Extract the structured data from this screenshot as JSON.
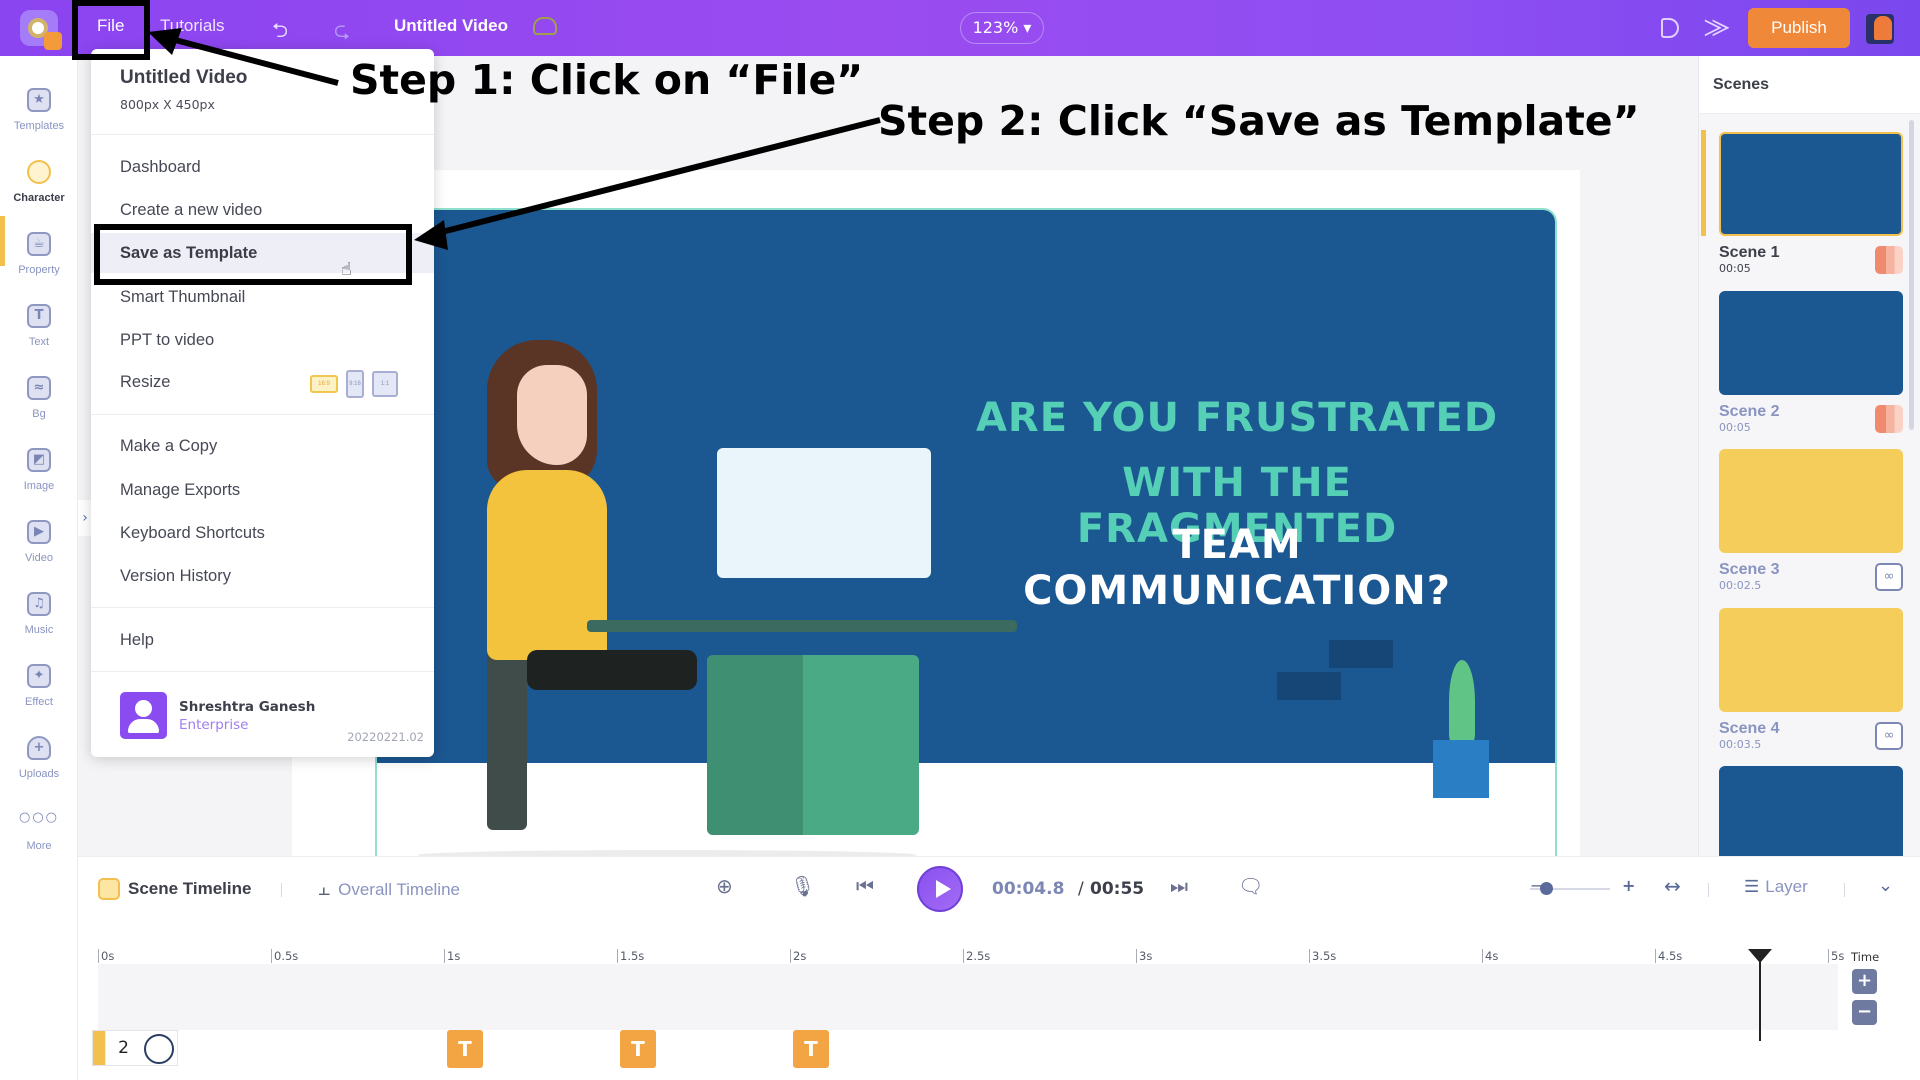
{
  "topbar": {
    "file_label": "File",
    "tutorials_label": "Tutorials",
    "title": "Untitled Video",
    "zoom_level": "123%",
    "publish_label": "Publish",
    "icons": [
      "logo",
      "undo-icon",
      "redo-icon",
      "cloud-saved-icon",
      "preview-icon",
      "share-icon",
      "user-avatar"
    ]
  },
  "sidebar": {
    "items": [
      {
        "label": "Templates",
        "icon": "templates-icon"
      },
      {
        "label": "Character",
        "icon": "character-icon",
        "active": true
      },
      {
        "label": "Property",
        "icon": "property-icon"
      },
      {
        "label": "Text",
        "icon": "text-icon"
      },
      {
        "label": "Bg",
        "icon": "background-icon"
      },
      {
        "label": "Image",
        "icon": "image-icon"
      },
      {
        "label": "Video",
        "icon": "video-icon"
      },
      {
        "label": "Music",
        "icon": "music-icon"
      },
      {
        "label": "Effect",
        "icon": "effect-icon"
      },
      {
        "label": "Uploads",
        "icon": "upload-cloud-icon"
      },
      {
        "label": "More",
        "icon": "more-icon"
      }
    ]
  },
  "file_menu": {
    "title": "Untitled Video",
    "dimensions": "800px X 450px",
    "items": [
      {
        "label": "Dashboard"
      },
      {
        "label": "Create a new video"
      },
      {
        "label": "Save as Template",
        "highlighted": true
      },
      {
        "label": "Smart Thumbnail"
      },
      {
        "label": "PPT to video"
      },
      {
        "label": "Resize"
      },
      {
        "label": "Make a Copy"
      },
      {
        "label": "Manage Exports"
      },
      {
        "label": "Keyboard Shortcuts"
      },
      {
        "label": "Version History"
      },
      {
        "label": "Help"
      }
    ],
    "resize_options": [
      "16:9",
      "9:16",
      "1:1"
    ],
    "user": {
      "name": "Shreshtra Ganesh",
      "plan": "Enterprise"
    },
    "version": "20220221.02"
  },
  "annotations": {
    "step1": "Step 1: Click on “File”",
    "step2": "Step 2: Click “Save as Template”"
  },
  "slide": {
    "line1": "ARE YOU FRUSTRATED",
    "line2": "WITH THE FRAGMENTED",
    "line3": "TEAM COMMUNICATION?",
    "bg_color": "#1b5791",
    "accent_text_color": "#55d0b7"
  },
  "scenes_panel": {
    "title": "Scenes",
    "scenes": [
      {
        "name": "Scene 1",
        "duration": "00:05",
        "color": "#1b5791",
        "active": true
      },
      {
        "name": "Scene 2",
        "duration": "00:05",
        "color": "#1b5791"
      },
      {
        "name": "Scene 3",
        "duration": "00:02.5",
        "color": "#f4cd5a"
      },
      {
        "name": "Scene 4",
        "duration": "00:03.5",
        "color": "#f4cd5a"
      },
      {
        "name": "",
        "duration": "",
        "color": "#1b5791"
      }
    ]
  },
  "timeline": {
    "scene_tab": "Scene Timeline",
    "overall_tab": "Overall Timeline",
    "current_time": "00:04.8",
    "separator": "/",
    "total_time": "00:55",
    "layer_label": "Layer",
    "time_label": "Time",
    "ruler_ticks": [
      "0s",
      "0.5s",
      "1s",
      "1.5s",
      "2s",
      "2.5s",
      "3s",
      "3.5s",
      "4s",
      "4.5s",
      "5s"
    ],
    "playhead_seconds": 4.8,
    "start_block_number": "2",
    "text_markers": [
      {
        "label": "T",
        "time": 1.0
      },
      {
        "label": "T",
        "time": 1.5
      },
      {
        "label": "T",
        "time": 2.0
      }
    ],
    "plus_label": "+",
    "minus_label": "−"
  }
}
